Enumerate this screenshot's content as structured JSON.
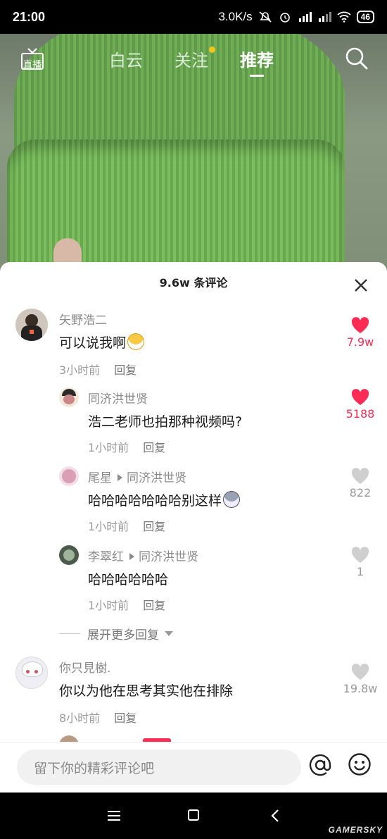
{
  "status_bar": {
    "time": "21:00",
    "net_speed": "3.0K/s",
    "battery": "46"
  },
  "top_nav": {
    "live_label": "直播",
    "tabs": [
      {
        "label": "白云"
      },
      {
        "label": "关注"
      },
      {
        "label": "推荐"
      }
    ]
  },
  "comments_panel": {
    "title": "9.6w 条评论",
    "reply_label": "回复",
    "expand_label": "展开更多回复",
    "comments": [
      {
        "user": "矢野浩二",
        "text": "可以说我啊",
        "time": "3小时前",
        "likes": "7.9w",
        "liked": true
      },
      {
        "user": "同济洪世贤",
        "text": "浩二老师也拍那种视频吗?",
        "time": "1小时前",
        "likes": "5188",
        "liked": true
      },
      {
        "user": "尾星",
        "reply_to": "同济洪世贤",
        "text": "哈哈哈哈哈哈哈别这样",
        "time": "1小时前",
        "likes": "822",
        "liked": false
      },
      {
        "user": "李翠红",
        "reply_to": "同济洪世贤",
        "text": "哈哈哈哈哈哈",
        "time": "1小时前",
        "likes": "1",
        "liked": false
      },
      {
        "user": "你只見樹.",
        "text": "你以为他在思考其实他在排除",
        "time": "8小时前",
        "likes": "19.8w",
        "liked": false
      }
    ]
  },
  "input_bar": {
    "placeholder": "留下你的精彩评论吧"
  },
  "watermark": "GAMERSKY",
  "colors": {
    "like_red": "#fe2c55",
    "heart_gray": "#cfcfcf",
    "dot_yellow": "#f5c518"
  }
}
